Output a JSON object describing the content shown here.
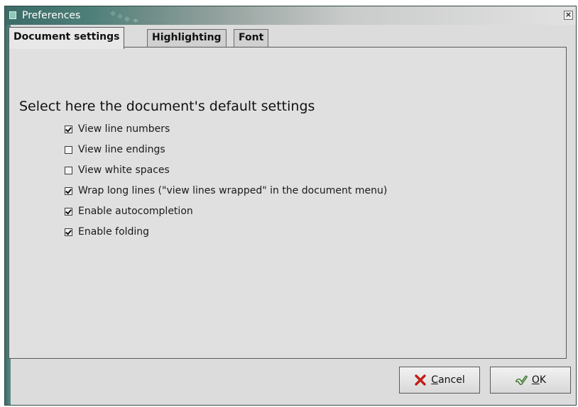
{
  "window": {
    "title": "Preferences",
    "close_glyph": "×"
  },
  "tabs": [
    {
      "label": "Document settings",
      "active": true
    },
    {
      "label": "Highlighting",
      "active": false
    },
    {
      "label": "Font",
      "active": false
    }
  ],
  "panel": {
    "heading": "Select here the document's default settings",
    "options": [
      {
        "label": "View line numbers",
        "checked": true
      },
      {
        "label": "View line endings",
        "checked": false
      },
      {
        "label": "View white spaces",
        "checked": false
      },
      {
        "label": "Wrap long lines (\"view lines wrapped\" in the document menu)",
        "checked": true
      },
      {
        "label": "Enable autocompletion",
        "checked": true
      },
      {
        "label": "Enable folding",
        "checked": true
      }
    ]
  },
  "buttons": {
    "cancel": {
      "mnemonic": "C",
      "rest": "ancel",
      "icon": "x-cancel-icon"
    },
    "ok": {
      "mnemonic": "O",
      "rest": "K",
      "icon": "ok-check-icon"
    }
  },
  "colors": {
    "titlebar_start": "#3b6b66",
    "cancel_icon": "#c0201a",
    "ok_icon": "#3c7a30"
  }
}
